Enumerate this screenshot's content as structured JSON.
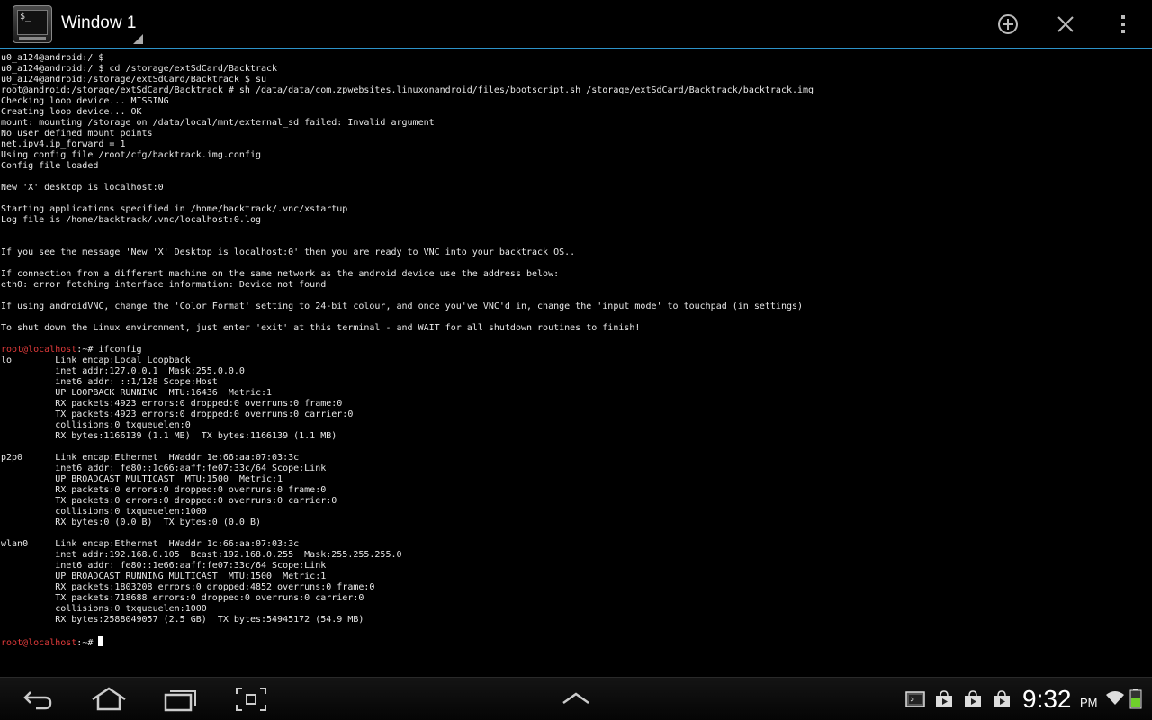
{
  "window": {
    "title": "Window 1"
  },
  "app_icon": {
    "glyph": "$_"
  },
  "actionbar": {
    "icons": [
      "add-window-icon",
      "close-window-icon",
      "overflow-menu-icon"
    ],
    "accent": "#2d93c9"
  },
  "terminal": {
    "prompt_color": "#e23b3b",
    "text_color": "#e8e8e8",
    "lines": [
      {
        "text": "u0_a124@android:/ $"
      },
      {
        "text": "u0_a124@android:/ $ cd /storage/extSdCard/Backtrack"
      },
      {
        "text": "u0_a124@android:/storage/extSdCard/Backtrack $ su"
      },
      {
        "text": "root@android:/storage/extSdCard/Backtrack # sh /data/data/com.zpwebsites.linuxonandroid/files/bootscript.sh /storage/extSdCard/Backtrack/backtrack.img"
      },
      {
        "text": "Checking loop device... MISSING"
      },
      {
        "text": "Creating loop device... OK"
      },
      {
        "text": "mount: mounting /storage on /data/local/mnt/external_sd failed: Invalid argument"
      },
      {
        "text": "No user defined mount points"
      },
      {
        "text": "net.ipv4.ip_forward = 1"
      },
      {
        "text": "Using config file /root/cfg/backtrack.img.config"
      },
      {
        "text": "Config file loaded"
      },
      {
        "text": ""
      },
      {
        "text": "New 'X' desktop is localhost:0"
      },
      {
        "text": ""
      },
      {
        "text": "Starting applications specified in /home/backtrack/.vnc/xstartup"
      },
      {
        "text": "Log file is /home/backtrack/.vnc/localhost:0.log"
      },
      {
        "text": ""
      },
      {
        "text": ""
      },
      {
        "text": "If you see the message 'New 'X' Desktop is localhost:0' then you are ready to VNC into your backtrack OS.."
      },
      {
        "text": ""
      },
      {
        "text": "If connection from a different machine on the same network as the android device use the address below:"
      },
      {
        "text": "eth0: error fetching interface information: Device not found"
      },
      {
        "text": ""
      },
      {
        "text": "If using androidVNC, change the 'Color Format' setting to 24-bit colour, and once you've VNC'd in, change the 'input mode' to touchpad (in settings)"
      },
      {
        "text": ""
      },
      {
        "text": "To shut down the Linux environment, just enter 'exit' at this terminal - and WAIT for all shutdown routines to finish!"
      },
      {
        "text": ""
      },
      {
        "prompt": "root@localhost",
        "text": ":~# ifconfig"
      },
      {
        "text": "lo        Link encap:Local Loopback"
      },
      {
        "text": "          inet addr:127.0.0.1  Mask:255.0.0.0"
      },
      {
        "text": "          inet6 addr: ::1/128 Scope:Host"
      },
      {
        "text": "          UP LOOPBACK RUNNING  MTU:16436  Metric:1"
      },
      {
        "text": "          RX packets:4923 errors:0 dropped:0 overruns:0 frame:0"
      },
      {
        "text": "          TX packets:4923 errors:0 dropped:0 overruns:0 carrier:0"
      },
      {
        "text": "          collisions:0 txqueuelen:0"
      },
      {
        "text": "          RX bytes:1166139 (1.1 MB)  TX bytes:1166139 (1.1 MB)"
      },
      {
        "text": ""
      },
      {
        "text": "p2p0      Link encap:Ethernet  HWaddr 1e:66:aa:07:03:3c"
      },
      {
        "text": "          inet6 addr: fe80::1c66:aaff:fe07:33c/64 Scope:Link"
      },
      {
        "text": "          UP BROADCAST MULTICAST  MTU:1500  Metric:1"
      },
      {
        "text": "          RX packets:0 errors:0 dropped:0 overruns:0 frame:0"
      },
      {
        "text": "          TX packets:0 errors:0 dropped:0 overruns:0 carrier:0"
      },
      {
        "text": "          collisions:0 txqueuelen:1000"
      },
      {
        "text": "          RX bytes:0 (0.0 B)  TX bytes:0 (0.0 B)"
      },
      {
        "text": ""
      },
      {
        "text": "wlan0     Link encap:Ethernet  HWaddr 1c:66:aa:07:03:3c"
      },
      {
        "text": "          inet addr:192.168.0.105  Bcast:192.168.0.255  Mask:255.255.255.0"
      },
      {
        "text": "          inet6 addr: fe80::1e66:aaff:fe07:33c/64 Scope:Link"
      },
      {
        "text": "          UP BROADCAST RUNNING MULTICAST  MTU:1500  Metric:1"
      },
      {
        "text": "          RX packets:1803208 errors:0 dropped:4852 overruns:0 frame:0"
      },
      {
        "text": "          TX packets:718688 errors:0 dropped:0 overruns:0 carrier:0"
      },
      {
        "text": "          collisions:0 txqueuelen:1000"
      },
      {
        "text": "          RX bytes:2588049057 (2.5 GB)  TX bytes:54945172 (54.9 MB)"
      },
      {
        "text": ""
      },
      {
        "prompt": "root@localhost",
        "text": ":~# ",
        "cursor": true
      }
    ]
  },
  "systembar": {
    "nav_icons": [
      "back-icon",
      "home-icon",
      "recent-apps-icon",
      "screenshot-icon"
    ],
    "center_icon": "expand-up-icon",
    "notification_icons": [
      "terminal-notification-icon",
      "store-download-icon",
      "store-download-icon",
      "store-download-icon"
    ],
    "clock": {
      "time": "9:32",
      "ampm": "PM"
    },
    "status_icons": [
      "wifi-icon",
      "battery-icon"
    ],
    "battery_color": "#6fcf2b"
  }
}
